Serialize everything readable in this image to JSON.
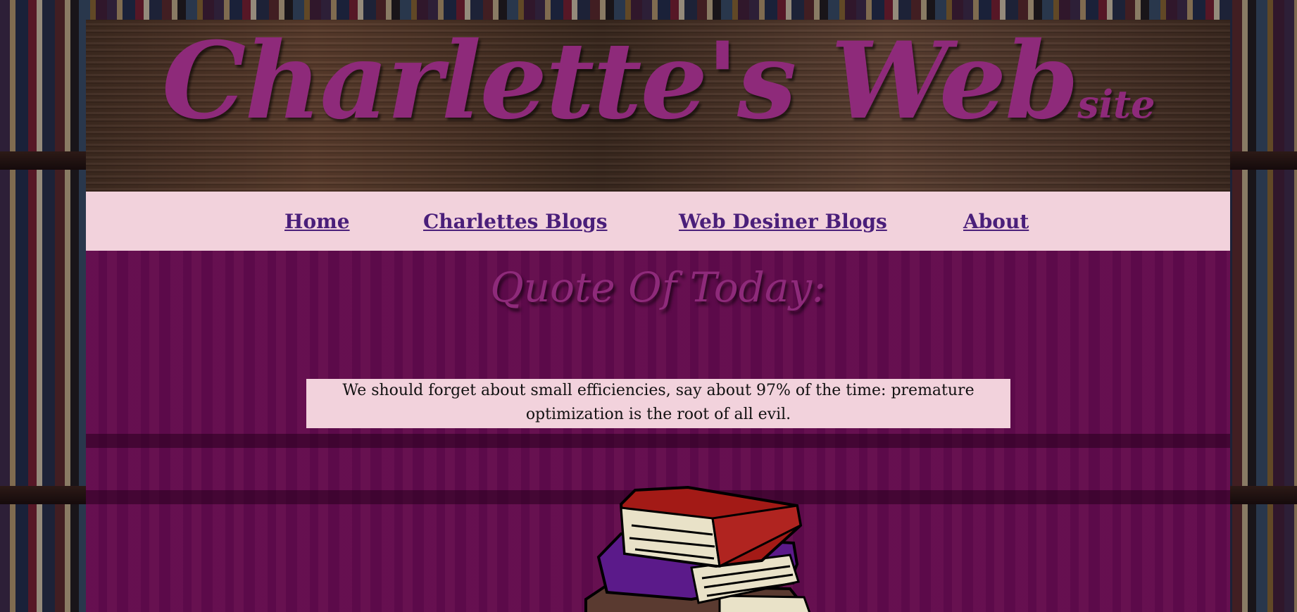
{
  "site": {
    "title": "Charlette's Web",
    "title_suffix": "site"
  },
  "nav": {
    "items": [
      {
        "label": "Home"
      },
      {
        "label": "Charlettes Blogs"
      },
      {
        "label": "Web Desiner Blogs"
      },
      {
        "label": "About"
      }
    ]
  },
  "main": {
    "heading": "Quote Of Today:",
    "quote": "We should forget about small efficiencies, say about 97% of the time: premature optimization is the root of all evil."
  },
  "colors": {
    "title": "#8e2a7a",
    "nav_background": "#f2d2dc",
    "nav_link": "#4a1f7a",
    "main_background": "#5c0a4a",
    "book_red": "#a31a16",
    "book_purple": "#5b1a8a",
    "book_brown": "#5a3a30"
  },
  "icons": {
    "illustration": "stack-of-books-icon"
  }
}
